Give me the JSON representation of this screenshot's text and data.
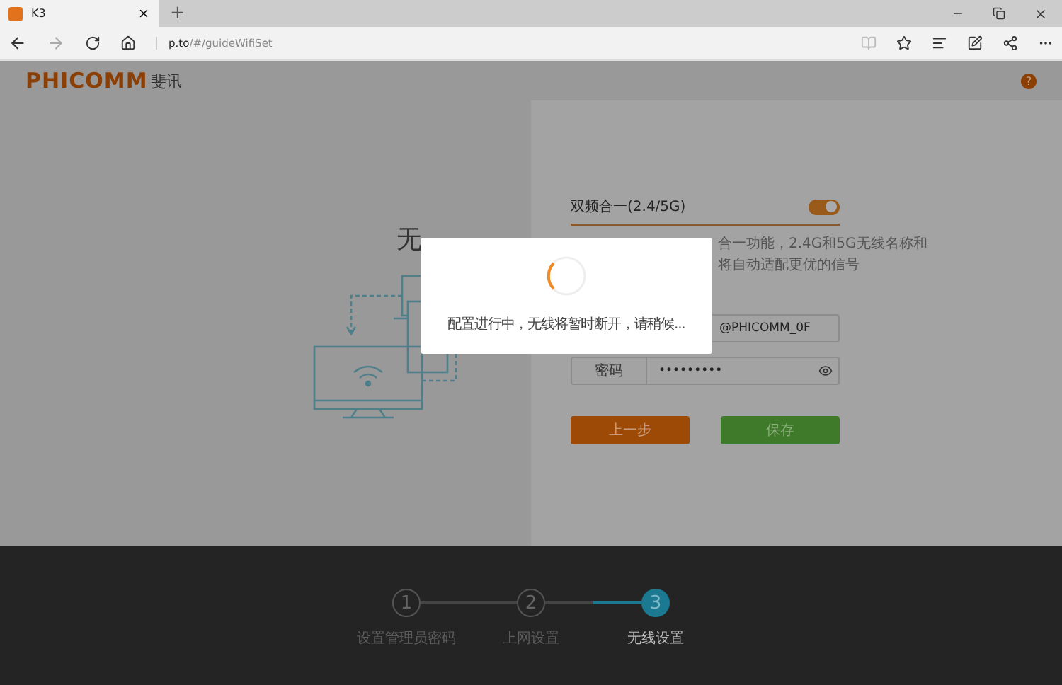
{
  "browser": {
    "tab": {
      "title": "K3"
    },
    "new_tab": "+",
    "address": {
      "host": "p.to",
      "path": "/#/guideWifiSet"
    }
  },
  "header": {
    "logo": "PHICOMM",
    "logo_cn": "斐讯",
    "help": "?"
  },
  "left": {
    "title_fragment": "无"
  },
  "form": {
    "band_toggle": {
      "label": "双频合一(2.4/5G)",
      "on": true
    },
    "description": [
      "合一功能，2.4G和5G无线名称和",
      "将自动适配更优的信号"
    ],
    "ssid_value": "@PHICOMM_0F",
    "password": {
      "label": "密码",
      "value": "•••••••••"
    },
    "buttons": [
      {
        "label": "上一步",
        "kind": "back"
      },
      {
        "label": "保存",
        "kind": "save"
      }
    ]
  },
  "dialog": {
    "message": "配置进行中，无线将暂时断开，请稍候..."
  },
  "steps": [
    {
      "number": "1",
      "label": "设置管理员密码",
      "selected": false
    },
    {
      "number": "2",
      "label": "上网设置",
      "selected": false
    },
    {
      "number": "3",
      "label": "无线设置",
      "selected": true
    }
  ]
}
